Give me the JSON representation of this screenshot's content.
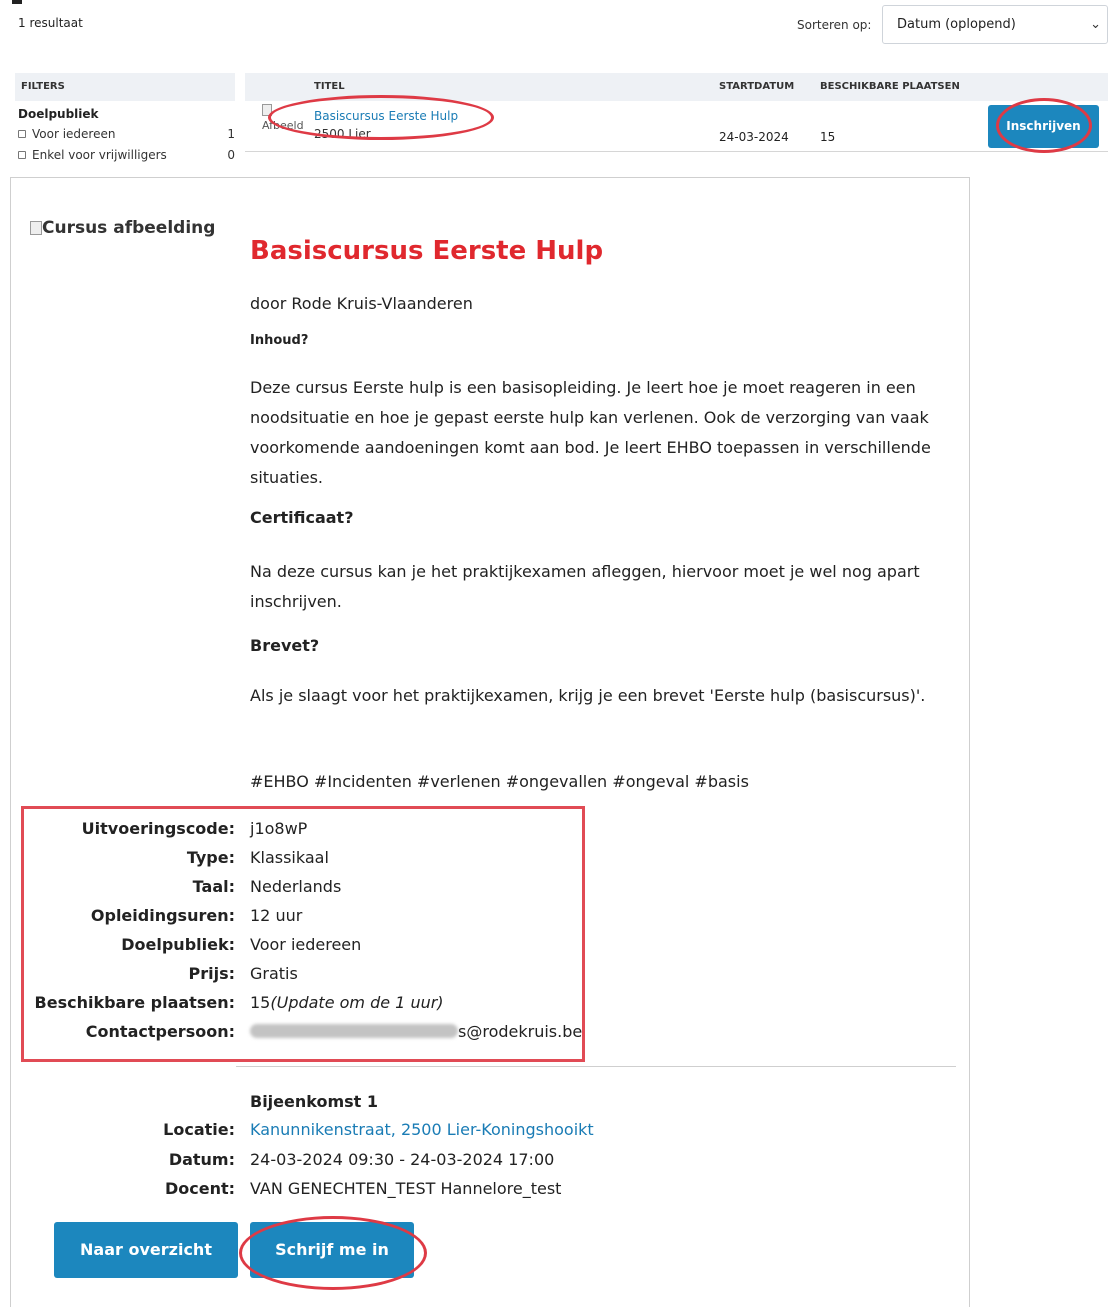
{
  "header": {
    "result_count": "1 resultaat",
    "sort_label": "Sorteren op:",
    "sort_value": "Datum (oplopend)"
  },
  "filters": {
    "heading": "FILTERS",
    "group_title": "Doelpubliek",
    "options": [
      {
        "label": "Voor iedereen",
        "count": "1"
      },
      {
        "label": "Enkel voor vrijwilligers",
        "count": "0"
      }
    ]
  },
  "table": {
    "columns": [
      "TITEL",
      "STARTDATUM",
      "BESCHIKBARE PLAATSEN"
    ],
    "rows": [
      {
        "thumb_alt": "Afbeeld",
        "title": "Basiscursus Eerste Hulp",
        "location": "2500 Lier",
        "start_date": "24-03-2024",
        "places": "15",
        "action_label": "Inschrijven"
      }
    ]
  },
  "detail": {
    "image_alt": "Cursus afbeelding",
    "title": "Basiscursus Eerste Hulp",
    "by_line": "door Rode Kruis-Vlaanderen",
    "sections": [
      {
        "heading": "Inhoud?",
        "text": "Deze cursus Eerste hulp is een basisopleiding. Je leert hoe je moet reageren in een noodsituatie en hoe je gepast eerste hulp kan verlenen. Ook de verzorging van vaak voorkomende aandoeningen komt aan bod. Je leert EHBO toepassen in verschillende situaties."
      },
      {
        "heading": "Certificaat?",
        "text": "Na deze cursus kan je het praktijkexamen afleggen, hiervoor moet je wel nog apart inschrijven."
      },
      {
        "heading": "Brevet?",
        "text": "Als je slaagt voor het praktijkexamen, krijg je een brevet 'Eerste hulp (basiscursus)'."
      }
    ],
    "hashtags": "#EHBO #Incidenten #verlenen #ongevallen #ongeval #basis",
    "info": [
      {
        "label": "Uitvoeringscode:",
        "value": "j1o8wP"
      },
      {
        "label": "Type:",
        "value": "Klassikaal"
      },
      {
        "label": "Taal:",
        "value": "Nederlands"
      },
      {
        "label": "Opleidingsuren:",
        "value": "12 uur"
      },
      {
        "label": "Doelpubliek:",
        "value": "Voor iedereen"
      },
      {
        "label": "Prijs:",
        "value": "Gratis"
      },
      {
        "label": "Beschikbare plaatsen:",
        "value": "15",
        "note": "(Update om de 1 uur)"
      },
      {
        "label": "Contactpersoon:",
        "value": "s@rodekruis.be"
      }
    ],
    "session": {
      "title": "Bijeenkomst 1",
      "rows": [
        {
          "label": "Locatie:",
          "value": "Kanunnikenstraat, 2500 Lier-Koningshooikt"
        },
        {
          "label": "Datum:",
          "value": "24-03-2024 09:30 - 24-03-2024 17:00"
        },
        {
          "label": "Docent:",
          "value": "VAN GENECHTEN_TEST Hannelore_test"
        }
      ]
    },
    "buttons": {
      "overview": "Naar overzicht",
      "signup": "Schrijf me in"
    }
  },
  "colors": {
    "accent": "#1c87be",
    "title_red": "#e0282e",
    "highlight": "#de3a45",
    "link": "#1a7cb5"
  }
}
